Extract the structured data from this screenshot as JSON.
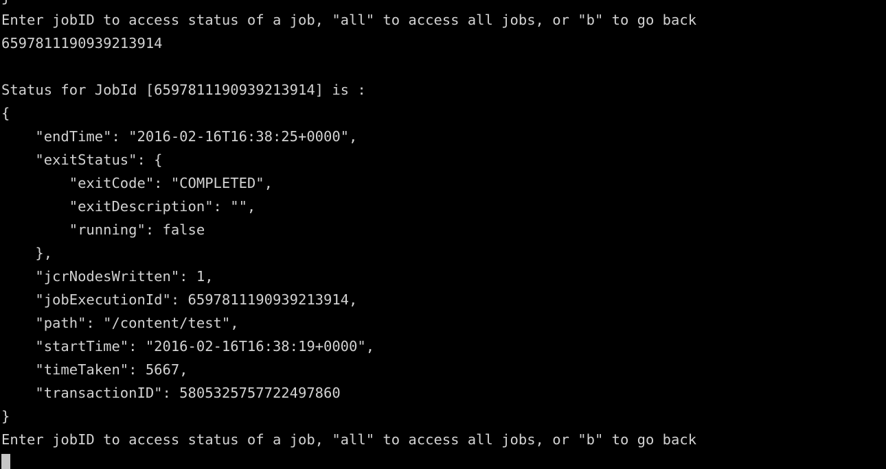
{
  "terminal": {
    "background_color": "#000000",
    "foreground_color": "#d2d2d2",
    "cursor_color": "#c6c6c6",
    "cursor_shape": "block",
    "columns": 92,
    "rows": 21
  },
  "session": {
    "prompt_text": "Enter jobID to access status of a job, \"all\" to access all jobs, or \"b\" to go back",
    "entered_job_id": "6597811190939213914",
    "status_header": "Status for JobId [6597811190939213914] is :"
  },
  "job_status": {
    "endTime": "2016-02-16T16:38:25+0000",
    "exitStatus": {
      "exitCode": "COMPLETED",
      "exitDescription": "",
      "running": "false"
    },
    "jcrNodesWritten": "1",
    "jobExecutionId": "6597811190939213914",
    "path": "/content/test",
    "startTime": "2016-02-16T16:38:19+0000",
    "timeTaken": "5667",
    "transactionID": "5805325757722497860"
  },
  "lines": [
    {
      "id": "line-clipped-top",
      "text": "j"
    },
    {
      "id": "line-prompt-top",
      "text": "Enter jobID to access status of a job, \"all\" to access all jobs, or \"b\" to go back"
    },
    {
      "id": "line-user-input-jobid",
      "text": "6597811190939213914"
    },
    {
      "id": "line-blank-1",
      "text": " "
    },
    {
      "id": "line-status-header",
      "text": "Status for JobId [6597811190939213914] is :"
    },
    {
      "id": "line-json-open-brace",
      "text": "{"
    },
    {
      "id": "line-json-endtime",
      "text": "    \"endTime\": \"2016-02-16T16:38:25+0000\","
    },
    {
      "id": "line-json-exitstatus-open",
      "text": "    \"exitStatus\": {"
    },
    {
      "id": "line-json-exitcode",
      "text": "        \"exitCode\": \"COMPLETED\","
    },
    {
      "id": "line-json-exitdescription",
      "text": "        \"exitDescription\": \"\","
    },
    {
      "id": "line-json-running",
      "text": "        \"running\": false"
    },
    {
      "id": "line-json-exitstatus-close",
      "text": "    },"
    },
    {
      "id": "line-json-jcrnodeswritten",
      "text": "    \"jcrNodesWritten\": 1,"
    },
    {
      "id": "line-json-jobexecutionid",
      "text": "    \"jobExecutionId\": 6597811190939213914,"
    },
    {
      "id": "line-json-path",
      "text": "    \"path\": \"/content/test\","
    },
    {
      "id": "line-json-starttime",
      "text": "    \"startTime\": \"2016-02-16T16:38:19+0000\","
    },
    {
      "id": "line-json-timetaken",
      "text": "    \"timeTaken\": 5667,"
    },
    {
      "id": "line-json-transactionid",
      "text": "    \"transactionID\": 5805325757722497860"
    },
    {
      "id": "line-json-close-brace",
      "text": "}"
    },
    {
      "id": "line-prompt-bottom",
      "text": "Enter jobID to access status of a job, \"all\" to access all jobs, or \"b\" to go back"
    }
  ]
}
